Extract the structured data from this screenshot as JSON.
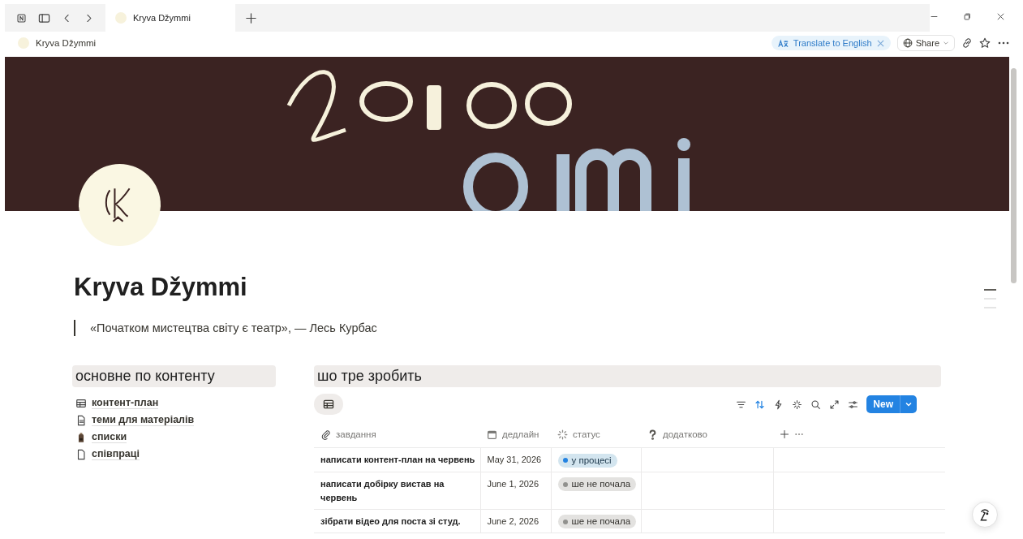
{
  "browser": {
    "tab": {
      "title": "Kryva Džymmi",
      "selected": true
    }
  },
  "topbar": {
    "breadcrumb": "Kryva Džymmi",
    "translate": "Translate to English",
    "share": "Share"
  },
  "page": {
    "title": "Kryva Džymmi",
    "quote": "«Початком мистецтва світу є театр», — Лесь Курбас"
  },
  "content_section": {
    "heading": "основне по контенту",
    "links": [
      {
        "label": "контент-план",
        "kind": "table"
      },
      {
        "label": "теми для матеріалів",
        "kind": "doc"
      },
      {
        "label": "списки",
        "kind": "emoji"
      },
      {
        "label": "співпраці",
        "kind": "page"
      }
    ]
  },
  "tasks": {
    "heading": "шо тре зробить",
    "sort_active": true,
    "new_button": "New",
    "columns": [
      {
        "label": "завдання",
        "kind": "text"
      },
      {
        "label": "дедлайн",
        "kind": "date"
      },
      {
        "label": "статус",
        "kind": "status"
      },
      {
        "label": "додатково",
        "kind": "unknown"
      }
    ],
    "rows": [
      {
        "task": "написати контент-план на червень",
        "deadline": "May 31, 2026",
        "status": {
          "label": "у процесі",
          "kind": "in_progress",
          "color": "#2383e2"
        }
      },
      {
        "task": "написати добірку вистав на червень",
        "deadline": "June 1, 2026",
        "status": {
          "label": "ше не почала",
          "kind": "not_started",
          "color": "#91918e"
        }
      },
      {
        "task": "зібрати відео для поста зі студ.",
        "deadline": "June 2, 2026",
        "status": {
          "label": "ше не почала",
          "kind": "not_started",
          "color": "#91918e"
        }
      }
    ]
  }
}
